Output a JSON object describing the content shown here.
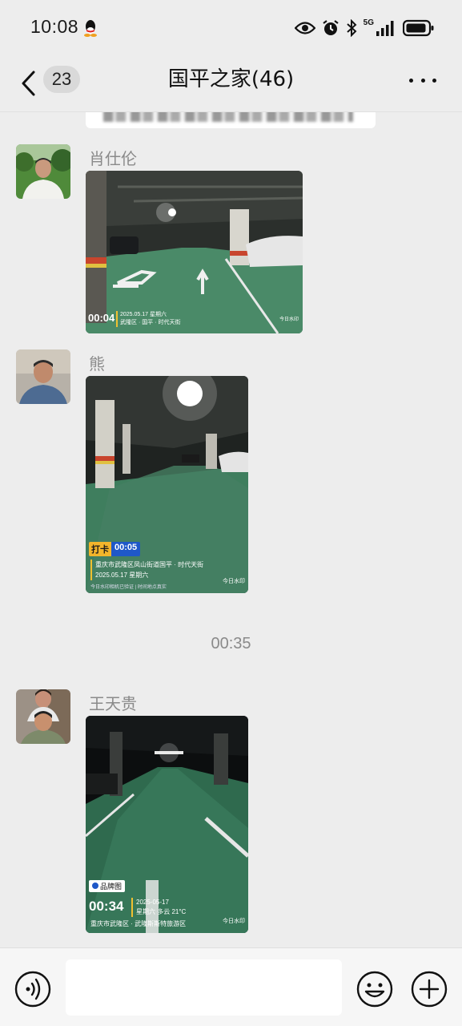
{
  "status_bar": {
    "time": "10:08",
    "network": "5G",
    "icons": [
      "qq-icon",
      "eye-icon",
      "alarm-icon",
      "bluetooth-icon",
      "signal-icon",
      "battery-icon"
    ]
  },
  "nav": {
    "unread_count": "23",
    "title": "国平之家(46)",
    "icons": [
      "back-chevron-icon",
      "more-icon"
    ]
  },
  "messages": [
    {
      "sender": "肖仕伦",
      "type": "image",
      "image_description": "underground parking garage, green floor with white arrows",
      "watermark": {
        "time": "00:04",
        "date": "2025.05.17 星期六",
        "location": "武隆区 · 国平 · 时代天街",
        "brand": "今日水印"
      }
    },
    {
      "sender": "熊",
      "type": "image",
      "image_description": "underground parking garage with bright ceiling light",
      "watermark": {
        "tag": "打卡",
        "time": "00:05",
        "location": "重庆市武隆区凤山街道国平 · 时代天街",
        "date": "2025.05.17 星期六",
        "verify": "今日水印相机已验证 | 时间地点真实",
        "brand": "今日水印"
      }
    },
    {
      "sender": "王天贵",
      "type": "image",
      "image_description": "dark underground parking lane",
      "watermark": {
        "tag": "品牌图",
        "time": "00:34",
        "date": "2025-05-17",
        "weekday_weather": "星期六  多云 21°C",
        "location": "重庆市武隆区 · 武隆斯斯特旅游区",
        "brand": "今日水印"
      }
    }
  ],
  "time_divider": "00:35",
  "input_bar": {
    "icons": [
      "voice-icon",
      "emoji-icon",
      "plus-icon"
    ]
  },
  "colors": {
    "background": "#ededed",
    "bubble": "#ffffff",
    "secondary_text": "#8a8a8a",
    "garage_green": "#3f7e5e"
  }
}
